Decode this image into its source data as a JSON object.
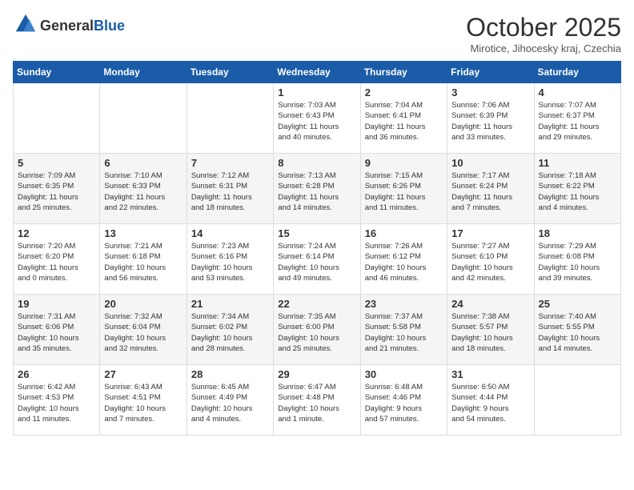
{
  "header": {
    "logo_line1": "General",
    "logo_line2": "Blue",
    "month": "October 2025",
    "location": "Mirotice, Jihocesky kraj, Czechia"
  },
  "days_of_week": [
    "Sunday",
    "Monday",
    "Tuesday",
    "Wednesday",
    "Thursday",
    "Friday",
    "Saturday"
  ],
  "weeks": [
    [
      {
        "day": "",
        "info": ""
      },
      {
        "day": "",
        "info": ""
      },
      {
        "day": "",
        "info": ""
      },
      {
        "day": "1",
        "info": "Sunrise: 7:03 AM\nSunset: 6:43 PM\nDaylight: 11 hours\nand 40 minutes."
      },
      {
        "day": "2",
        "info": "Sunrise: 7:04 AM\nSunset: 6:41 PM\nDaylight: 11 hours\nand 36 minutes."
      },
      {
        "day": "3",
        "info": "Sunrise: 7:06 AM\nSunset: 6:39 PM\nDaylight: 11 hours\nand 33 minutes."
      },
      {
        "day": "4",
        "info": "Sunrise: 7:07 AM\nSunset: 6:37 PM\nDaylight: 11 hours\nand 29 minutes."
      }
    ],
    [
      {
        "day": "5",
        "info": "Sunrise: 7:09 AM\nSunset: 6:35 PM\nDaylight: 11 hours\nand 25 minutes."
      },
      {
        "day": "6",
        "info": "Sunrise: 7:10 AM\nSunset: 6:33 PM\nDaylight: 11 hours\nand 22 minutes."
      },
      {
        "day": "7",
        "info": "Sunrise: 7:12 AM\nSunset: 6:31 PM\nDaylight: 11 hours\nand 18 minutes."
      },
      {
        "day": "8",
        "info": "Sunrise: 7:13 AM\nSunset: 6:28 PM\nDaylight: 11 hours\nand 14 minutes."
      },
      {
        "day": "9",
        "info": "Sunrise: 7:15 AM\nSunset: 6:26 PM\nDaylight: 11 hours\nand 11 minutes."
      },
      {
        "day": "10",
        "info": "Sunrise: 7:17 AM\nSunset: 6:24 PM\nDaylight: 11 hours\nand 7 minutes."
      },
      {
        "day": "11",
        "info": "Sunrise: 7:18 AM\nSunset: 6:22 PM\nDaylight: 11 hours\nand 4 minutes."
      }
    ],
    [
      {
        "day": "12",
        "info": "Sunrise: 7:20 AM\nSunset: 6:20 PM\nDaylight: 11 hours\nand 0 minutes."
      },
      {
        "day": "13",
        "info": "Sunrise: 7:21 AM\nSunset: 6:18 PM\nDaylight: 10 hours\nand 56 minutes."
      },
      {
        "day": "14",
        "info": "Sunrise: 7:23 AM\nSunset: 6:16 PM\nDaylight: 10 hours\nand 53 minutes."
      },
      {
        "day": "15",
        "info": "Sunrise: 7:24 AM\nSunset: 6:14 PM\nDaylight: 10 hours\nand 49 minutes."
      },
      {
        "day": "16",
        "info": "Sunrise: 7:26 AM\nSunset: 6:12 PM\nDaylight: 10 hours\nand 46 minutes."
      },
      {
        "day": "17",
        "info": "Sunrise: 7:27 AM\nSunset: 6:10 PM\nDaylight: 10 hours\nand 42 minutes."
      },
      {
        "day": "18",
        "info": "Sunrise: 7:29 AM\nSunset: 6:08 PM\nDaylight: 10 hours\nand 39 minutes."
      }
    ],
    [
      {
        "day": "19",
        "info": "Sunrise: 7:31 AM\nSunset: 6:06 PM\nDaylight: 10 hours\nand 35 minutes."
      },
      {
        "day": "20",
        "info": "Sunrise: 7:32 AM\nSunset: 6:04 PM\nDaylight: 10 hours\nand 32 minutes."
      },
      {
        "day": "21",
        "info": "Sunrise: 7:34 AM\nSunset: 6:02 PM\nDaylight: 10 hours\nand 28 minutes."
      },
      {
        "day": "22",
        "info": "Sunrise: 7:35 AM\nSunset: 6:00 PM\nDaylight: 10 hours\nand 25 minutes."
      },
      {
        "day": "23",
        "info": "Sunrise: 7:37 AM\nSunset: 5:58 PM\nDaylight: 10 hours\nand 21 minutes."
      },
      {
        "day": "24",
        "info": "Sunrise: 7:38 AM\nSunset: 5:57 PM\nDaylight: 10 hours\nand 18 minutes."
      },
      {
        "day": "25",
        "info": "Sunrise: 7:40 AM\nSunset: 5:55 PM\nDaylight: 10 hours\nand 14 minutes."
      }
    ],
    [
      {
        "day": "26",
        "info": "Sunrise: 6:42 AM\nSunset: 4:53 PM\nDaylight: 10 hours\nand 11 minutes."
      },
      {
        "day": "27",
        "info": "Sunrise: 6:43 AM\nSunset: 4:51 PM\nDaylight: 10 hours\nand 7 minutes."
      },
      {
        "day": "28",
        "info": "Sunrise: 6:45 AM\nSunset: 4:49 PM\nDaylight: 10 hours\nand 4 minutes."
      },
      {
        "day": "29",
        "info": "Sunrise: 6:47 AM\nSunset: 4:48 PM\nDaylight: 10 hours\nand 1 minute."
      },
      {
        "day": "30",
        "info": "Sunrise: 6:48 AM\nSunset: 4:46 PM\nDaylight: 9 hours\nand 57 minutes."
      },
      {
        "day": "31",
        "info": "Sunrise: 6:50 AM\nSunset: 4:44 PM\nDaylight: 9 hours\nand 54 minutes."
      },
      {
        "day": "",
        "info": ""
      }
    ]
  ]
}
